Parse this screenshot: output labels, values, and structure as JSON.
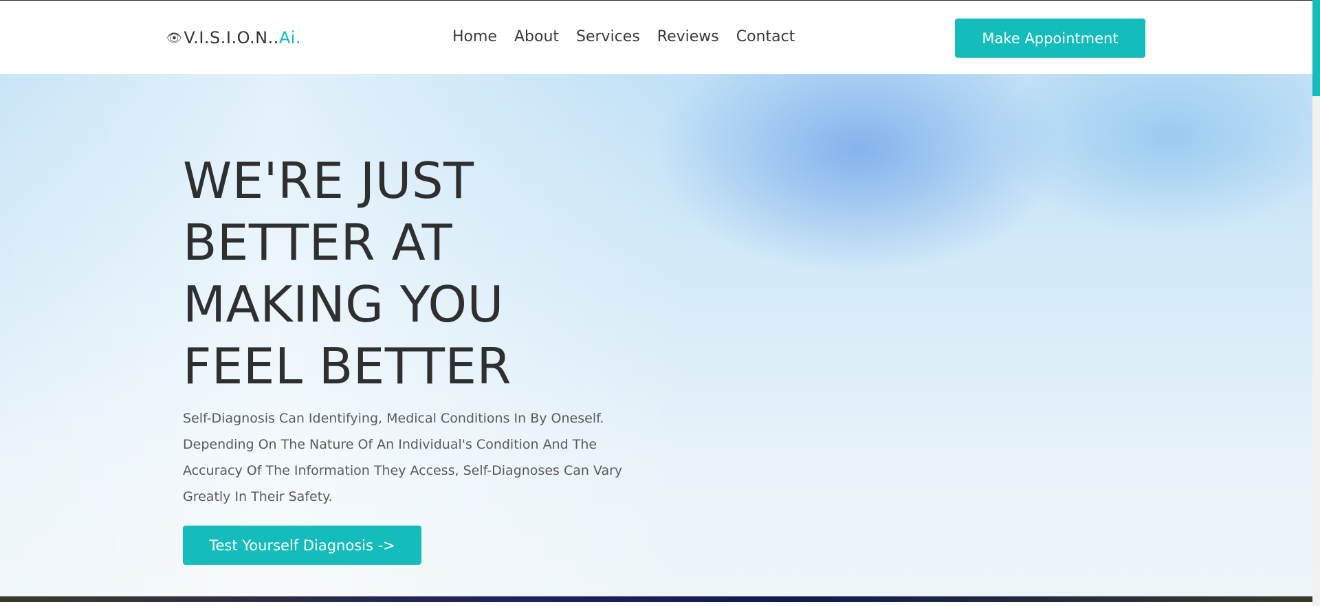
{
  "header": {
    "logo_icon": "eye-icon",
    "logo_icon_glyph": "👁",
    "logo_text": "V.I.S.I.O.N..",
    "logo_accent": "Ai.",
    "nav": [
      "Home",
      "About",
      "Services",
      "Reviews",
      "Contact"
    ],
    "cta_label": "Make Appointment"
  },
  "hero": {
    "headline_lines": [
      "WE'RE JUST",
      "BETTER AT",
      "MAKING YOU",
      "FEEL BETTER"
    ],
    "description": "Self-Diagnosis Can Identifying, Medical Conditions In By Oneself. Depending On The Nature Of An Individual's Condition And The Accuracy Of The Information They Access, Self-Diagnoses Can Vary Greatly In Their Safety.",
    "cta_label": "Test Yourself Diagnosis ->"
  },
  "colors": {
    "accent": "#14bdbb",
    "headline": "#2f2f2f",
    "body_text": "#5a5a5a"
  }
}
